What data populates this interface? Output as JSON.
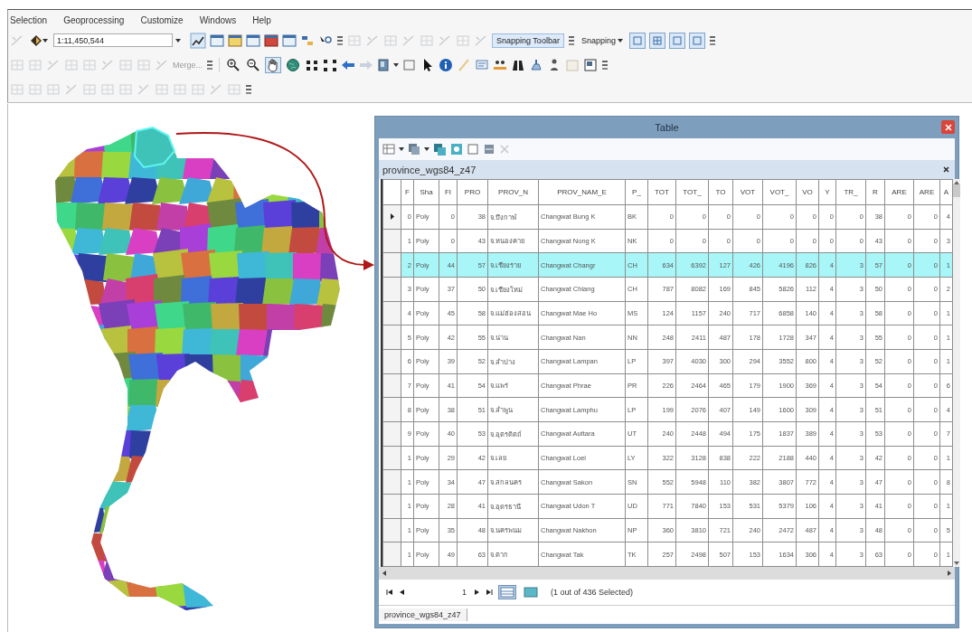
{
  "menu": [
    "Selection",
    "Geoprocessing",
    "Customize",
    "Windows",
    "Help"
  ],
  "scale": {
    "value": "1:11,450,544"
  },
  "edit_tools": {
    "merge_label": "Merge..."
  },
  "navigation_tools": [
    {
      "selected": false
    },
    {
      "selected": false
    },
    {
      "selected": true
    },
    {
      "selected": false
    }
  ],
  "snapping": {
    "toolbar_button": "Snapping Toolbar",
    "dropdown": "Snapping",
    "toggles": [
      {
        "on": true
      },
      {
        "on": true
      },
      {
        "on": true
      },
      {
        "on": true
      }
    ]
  },
  "table_window": {
    "title": "Table",
    "tab": "province_wgs84_z47",
    "columns": [
      "F",
      "Sha",
      "FI",
      "PRO",
      "PROV_N",
      "PROV_NAM_E",
      "P_",
      "TOT",
      "TOT_",
      "TO",
      "VOT",
      "VOT_",
      "VO",
      "Y",
      "TR_",
      "R",
      "ARE",
      "ARE",
      "A"
    ],
    "rows": [
      {
        "current": true,
        "selected": false,
        "cells": [
          "0",
          "Poly",
          "0",
          "38",
          "จ.บึงกาฬ",
          "Changwat Bung K",
          "BK",
          "0",
          "0",
          "0",
          "0",
          "0",
          "0",
          "0",
          "0",
          "38",
          "0",
          "0",
          "4"
        ]
      },
      {
        "current": false,
        "selected": false,
        "cells": [
          "1",
          "Poly",
          "0",
          "43",
          "จ.หนองคาย",
          "Changwat Nong K",
          "NK",
          "0",
          "0",
          "0",
          "0",
          "0",
          "0",
          "0",
          "0",
          "43",
          "0",
          "0",
          "3"
        ]
      },
      {
        "current": false,
        "selected": true,
        "cells": [
          "2",
          "Poly",
          "44",
          "57",
          "จ.เชียงราย",
          "Changwat Changr",
          "CH",
          "634",
          "6392",
          "127",
          "426",
          "4196",
          "826",
          "4",
          "3",
          "57",
          "0",
          "0",
          "1"
        ]
      },
      {
        "current": false,
        "selected": false,
        "cells": [
          "3",
          "Poly",
          "37",
          "50",
          "จ.เชียงใหม่",
          "Changwat Chiang",
          "CH",
          "787",
          "8082",
          "169",
          "845",
          "5826",
          "112",
          "4",
          "3",
          "50",
          "0",
          "0",
          "2"
        ]
      },
      {
        "current": false,
        "selected": false,
        "cells": [
          "4",
          "Poly",
          "45",
          "58",
          "จ.แม่ฮ่องสอน",
          "Changwat Mae Ho",
          "MS",
          "124",
          "1157",
          "240",
          "717",
          "6858",
          "140",
          "4",
          "3",
          "58",
          "0",
          "0",
          "1"
        ]
      },
      {
        "current": false,
        "selected": false,
        "cells": [
          "5",
          "Poly",
          "42",
          "55",
          "จ.น่าน",
          "Changwat Nan",
          "NN",
          "248",
          "2411",
          "487",
          "178",
          "1728",
          "347",
          "4",
          "3",
          "55",
          "0",
          "0",
          "1"
        ]
      },
      {
        "current": false,
        "selected": false,
        "cells": [
          "6",
          "Poly",
          "39",
          "52",
          "จ.ลำปาง",
          "Changwat Lampan",
          "LP",
          "397",
          "4030",
          "300",
          "294",
          "3552",
          "800",
          "4",
          "3",
          "52",
          "0",
          "0",
          "1"
        ]
      },
      {
        "current": false,
        "selected": false,
        "cells": [
          "7",
          "Poly",
          "41",
          "54",
          "จ.แพร่",
          "Changwat Phrae",
          "PR",
          "226",
          "2464",
          "465",
          "179",
          "1900",
          "369",
          "4",
          "3",
          "54",
          "0",
          "0",
          "6"
        ]
      },
      {
        "current": false,
        "selected": false,
        "cells": [
          "8",
          "Poly",
          "38",
          "51",
          "จ.ลำพูน",
          "Changwat Lamphu",
          "LP",
          "199",
          "2076",
          "407",
          "149",
          "1600",
          "309",
          "4",
          "3",
          "51",
          "0",
          "0",
          "4"
        ]
      },
      {
        "current": false,
        "selected": false,
        "cells": [
          "9",
          "Poly",
          "40",
          "53",
          "จ.อุตรดิตถ์",
          "Changwat Auttara",
          "UT",
          "240",
          "2448",
          "494",
          "175",
          "1837",
          "389",
          "4",
          "3",
          "53",
          "0",
          "0",
          "7"
        ]
      },
      {
        "current": false,
        "selected": false,
        "cells": [
          "1",
          "Poly",
          "29",
          "42",
          "จ.เลย",
          "Changwat Loei",
          "LY",
          "322",
          "3128",
          "838",
          "222",
          "2188",
          "440",
          "4",
          "3",
          "42",
          "0",
          "0",
          "1"
        ]
      },
      {
        "current": false,
        "selected": false,
        "cells": [
          "1",
          "Poly",
          "34",
          "47",
          "จ.สกลนคร",
          "Changwat Sakon",
          "SN",
          "552",
          "5948",
          "110",
          "382",
          "3807",
          "772",
          "4",
          "3",
          "47",
          "0",
          "0",
          "8"
        ]
      },
      {
        "current": false,
        "selected": false,
        "cells": [
          "1",
          "Poly",
          "28",
          "41",
          "จ.อุดรธานี",
          "Changwat Udon T",
          "UD",
          "771",
          "7840",
          "153",
          "531",
          "5379",
          "106",
          "4",
          "3",
          "41",
          "0",
          "0",
          "1"
        ]
      },
      {
        "current": false,
        "selected": false,
        "cells": [
          "1",
          "Poly",
          "35",
          "48",
          "จ.นครพนม",
          "Changwat Nakhon",
          "NP",
          "360",
          "3810",
          "721",
          "240",
          "2472",
          "487",
          "4",
          "3",
          "48",
          "0",
          "0",
          "5"
        ]
      },
      {
        "current": false,
        "selected": false,
        "cells": [
          "1",
          "Poly",
          "49",
          "63",
          "จ.ตาก",
          "Changwat Tak",
          "TK",
          "257",
          "2498",
          "507",
          "153",
          "1634",
          "306",
          "4",
          "3",
          "63",
          "0",
          "0",
          "1"
        ]
      }
    ],
    "footer": {
      "record": "1",
      "view_buttons": [
        {
          "selected": true
        },
        {
          "selected": false
        }
      ],
      "status": "(1 out of 436 Selected)"
    },
    "bottom_tab": "province_wgs84_z47"
  }
}
